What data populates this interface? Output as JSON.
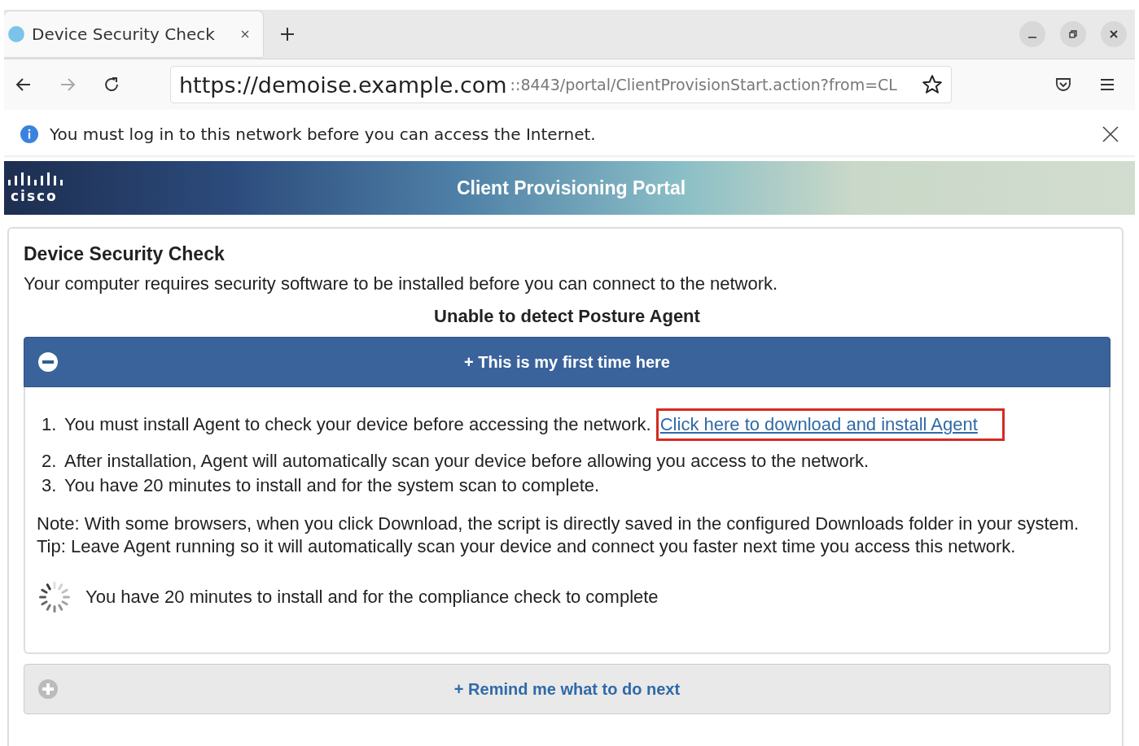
{
  "browser": {
    "tabs": [
      {
        "title": "Device Security Check",
        "selected": true
      }
    ],
    "address": {
      "host": "https://demoise.example.com",
      "rest": "::8443/portal/ClientProvisionStart.action?from=CL"
    },
    "notification": "You must log in to this network before you can access the Internet."
  },
  "banner": {
    "logo": "cisco",
    "title": "Client Provisioning Portal"
  },
  "page": {
    "heading": "Device Security Check",
    "intro": "Your computer requires security software to be installed before you can connect to the network.",
    "status": "Unable to detect Posture Agent",
    "panels": [
      {
        "title": "+ This is my first time here",
        "expanded": true,
        "steps": [
          {
            "number": "1.",
            "text": "You must install Agent to check your device before accessing the network.",
            "link": "Click here to download and install Agent"
          },
          {
            "number": "2.",
            "text": "After installation, Agent will automatically scan your device before allowing you access to the network."
          },
          {
            "number": "3.",
            "text": "You have 20 minutes to install and for the system scan to complete."
          }
        ],
        "note": "Note: With some browsers, when you click Download, the script is directly saved in the configured Downloads folder in your system.",
        "tip": "Tip: Leave Agent running so it will automatically scan your device and connect you faster next time you access this network.",
        "progress": "You have 20 minutes to install and for the compliance check to complete"
      },
      {
        "title": "+ Remind me what to do next",
        "expanded": false
      }
    ]
  }
}
